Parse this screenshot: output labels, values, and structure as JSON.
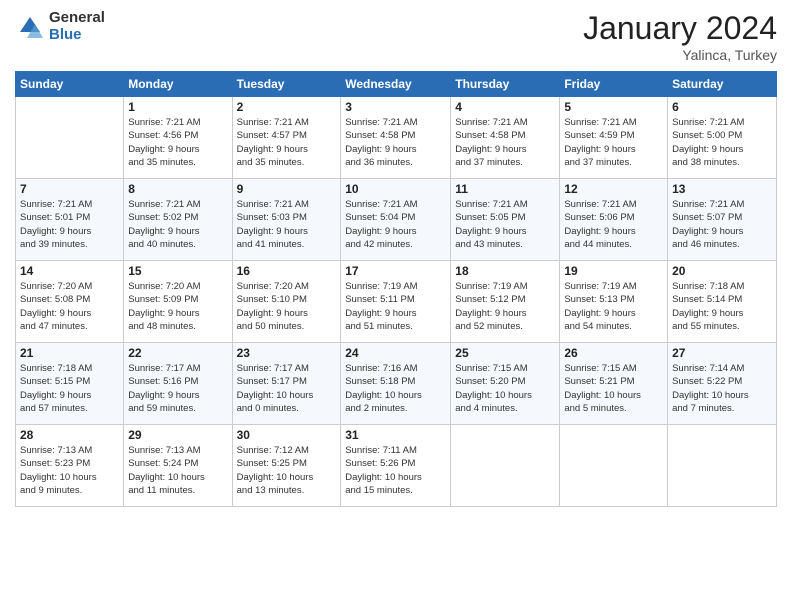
{
  "logo": {
    "general": "General",
    "blue": "Blue"
  },
  "header": {
    "month": "January 2024",
    "location": "Yalinca, Turkey"
  },
  "weekdays": [
    "Sunday",
    "Monday",
    "Tuesday",
    "Wednesday",
    "Thursday",
    "Friday",
    "Saturday"
  ],
  "weeks": [
    [
      {
        "day": "",
        "info": ""
      },
      {
        "day": "1",
        "info": "Sunrise: 7:21 AM\nSunset: 4:56 PM\nDaylight: 9 hours\nand 35 minutes."
      },
      {
        "day": "2",
        "info": "Sunrise: 7:21 AM\nSunset: 4:57 PM\nDaylight: 9 hours\nand 35 minutes."
      },
      {
        "day": "3",
        "info": "Sunrise: 7:21 AM\nSunset: 4:58 PM\nDaylight: 9 hours\nand 36 minutes."
      },
      {
        "day": "4",
        "info": "Sunrise: 7:21 AM\nSunset: 4:58 PM\nDaylight: 9 hours\nand 37 minutes."
      },
      {
        "day": "5",
        "info": "Sunrise: 7:21 AM\nSunset: 4:59 PM\nDaylight: 9 hours\nand 37 minutes."
      },
      {
        "day": "6",
        "info": "Sunrise: 7:21 AM\nSunset: 5:00 PM\nDaylight: 9 hours\nand 38 minutes."
      }
    ],
    [
      {
        "day": "7",
        "info": "Sunrise: 7:21 AM\nSunset: 5:01 PM\nDaylight: 9 hours\nand 39 minutes."
      },
      {
        "day": "8",
        "info": "Sunrise: 7:21 AM\nSunset: 5:02 PM\nDaylight: 9 hours\nand 40 minutes."
      },
      {
        "day": "9",
        "info": "Sunrise: 7:21 AM\nSunset: 5:03 PM\nDaylight: 9 hours\nand 41 minutes."
      },
      {
        "day": "10",
        "info": "Sunrise: 7:21 AM\nSunset: 5:04 PM\nDaylight: 9 hours\nand 42 minutes."
      },
      {
        "day": "11",
        "info": "Sunrise: 7:21 AM\nSunset: 5:05 PM\nDaylight: 9 hours\nand 43 minutes."
      },
      {
        "day": "12",
        "info": "Sunrise: 7:21 AM\nSunset: 5:06 PM\nDaylight: 9 hours\nand 44 minutes."
      },
      {
        "day": "13",
        "info": "Sunrise: 7:21 AM\nSunset: 5:07 PM\nDaylight: 9 hours\nand 46 minutes."
      }
    ],
    [
      {
        "day": "14",
        "info": "Sunrise: 7:20 AM\nSunset: 5:08 PM\nDaylight: 9 hours\nand 47 minutes."
      },
      {
        "day": "15",
        "info": "Sunrise: 7:20 AM\nSunset: 5:09 PM\nDaylight: 9 hours\nand 48 minutes."
      },
      {
        "day": "16",
        "info": "Sunrise: 7:20 AM\nSunset: 5:10 PM\nDaylight: 9 hours\nand 50 minutes."
      },
      {
        "day": "17",
        "info": "Sunrise: 7:19 AM\nSunset: 5:11 PM\nDaylight: 9 hours\nand 51 minutes."
      },
      {
        "day": "18",
        "info": "Sunrise: 7:19 AM\nSunset: 5:12 PM\nDaylight: 9 hours\nand 52 minutes."
      },
      {
        "day": "19",
        "info": "Sunrise: 7:19 AM\nSunset: 5:13 PM\nDaylight: 9 hours\nand 54 minutes."
      },
      {
        "day": "20",
        "info": "Sunrise: 7:18 AM\nSunset: 5:14 PM\nDaylight: 9 hours\nand 55 minutes."
      }
    ],
    [
      {
        "day": "21",
        "info": "Sunrise: 7:18 AM\nSunset: 5:15 PM\nDaylight: 9 hours\nand 57 minutes."
      },
      {
        "day": "22",
        "info": "Sunrise: 7:17 AM\nSunset: 5:16 PM\nDaylight: 9 hours\nand 59 minutes."
      },
      {
        "day": "23",
        "info": "Sunrise: 7:17 AM\nSunset: 5:17 PM\nDaylight: 10 hours\nand 0 minutes."
      },
      {
        "day": "24",
        "info": "Sunrise: 7:16 AM\nSunset: 5:18 PM\nDaylight: 10 hours\nand 2 minutes."
      },
      {
        "day": "25",
        "info": "Sunrise: 7:15 AM\nSunset: 5:20 PM\nDaylight: 10 hours\nand 4 minutes."
      },
      {
        "day": "26",
        "info": "Sunrise: 7:15 AM\nSunset: 5:21 PM\nDaylight: 10 hours\nand 5 minutes."
      },
      {
        "day": "27",
        "info": "Sunrise: 7:14 AM\nSunset: 5:22 PM\nDaylight: 10 hours\nand 7 minutes."
      }
    ],
    [
      {
        "day": "28",
        "info": "Sunrise: 7:13 AM\nSunset: 5:23 PM\nDaylight: 10 hours\nand 9 minutes."
      },
      {
        "day": "29",
        "info": "Sunrise: 7:13 AM\nSunset: 5:24 PM\nDaylight: 10 hours\nand 11 minutes."
      },
      {
        "day": "30",
        "info": "Sunrise: 7:12 AM\nSunset: 5:25 PM\nDaylight: 10 hours\nand 13 minutes."
      },
      {
        "day": "31",
        "info": "Sunrise: 7:11 AM\nSunset: 5:26 PM\nDaylight: 10 hours\nand 15 minutes."
      },
      {
        "day": "",
        "info": ""
      },
      {
        "day": "",
        "info": ""
      },
      {
        "day": "",
        "info": ""
      }
    ]
  ]
}
